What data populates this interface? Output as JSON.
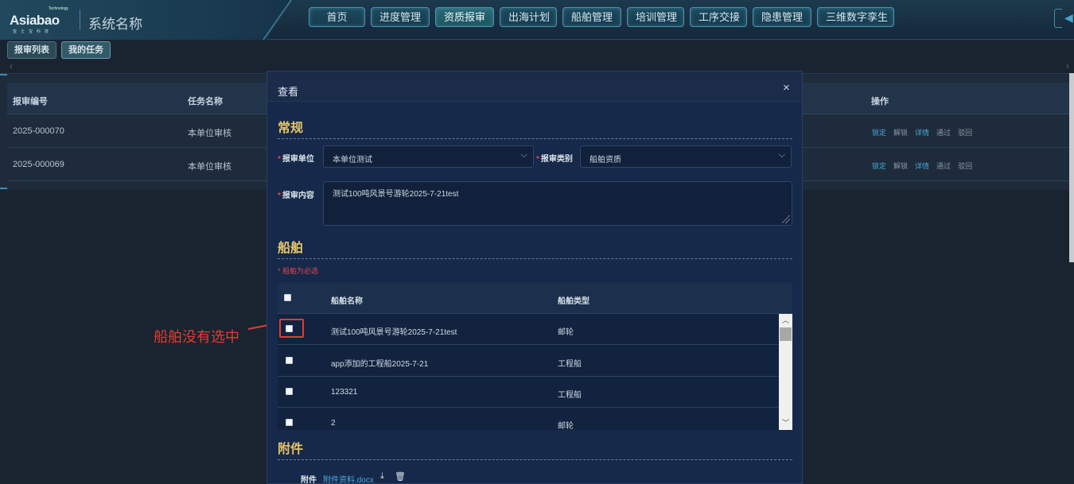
{
  "header": {
    "logo": {
      "brand": "Asiabao",
      "tagline": "Technology",
      "sub": "亚士宝科技"
    },
    "system_name": "系统名称",
    "nav": [
      {
        "label": "首页"
      },
      {
        "label": "进度管理"
      },
      {
        "label": "资质报审",
        "active": true
      },
      {
        "label": "出海计划"
      },
      {
        "label": "船舶管理"
      },
      {
        "label": "培训管理"
      },
      {
        "label": "工序交接"
      },
      {
        "label": "隐患管理"
      },
      {
        "label": "三维数字孪生"
      }
    ]
  },
  "subtabs": [
    {
      "label": "报审列表"
    },
    {
      "label": "我的任务",
      "active": true
    }
  ],
  "bg_table": {
    "headers": {
      "code": "报审编号",
      "task": "任务名称",
      "ops": "操作"
    },
    "rows": [
      {
        "code": "2025-000070",
        "task": "本单位审核"
      },
      {
        "code": "2025-000069",
        "task": "本单位审核"
      }
    ],
    "ops": [
      "锁定",
      "解锁",
      "详情",
      "通过",
      "驳回"
    ]
  },
  "modal": {
    "title": "查看",
    "close": "×",
    "general": {
      "title": "常规",
      "unit_label": "报审单位",
      "unit_value": "本单位测试",
      "type_label": "报审类别",
      "type_value": "船舶资质",
      "content_label": "报审内容",
      "content_value": "测试100吨风景号游轮2025-7-21test"
    },
    "ships": {
      "title": "船舶",
      "required_note": "* 船舶为必选",
      "col_name": "船舶名称",
      "col_type": "船舶类型",
      "rows": [
        {
          "name": "测试100吨风景号游轮2025-7-21test",
          "type": "邮轮"
        },
        {
          "name": "app添加的工程船2025-7-21",
          "type": "工程船"
        },
        {
          "name": "123321",
          "type": "工程船"
        },
        {
          "name": "2",
          "type": "邮轮"
        }
      ]
    },
    "attachments": {
      "title": "附件",
      "label": "附件",
      "file": "附件资料.docx"
    }
  },
  "annotation": "船舶没有选中",
  "colors": {
    "accent_gold": "#e6c46a",
    "required_red": "#e24848",
    "link_blue": "#4aa6d8",
    "annotation_red": "#e03c31"
  }
}
